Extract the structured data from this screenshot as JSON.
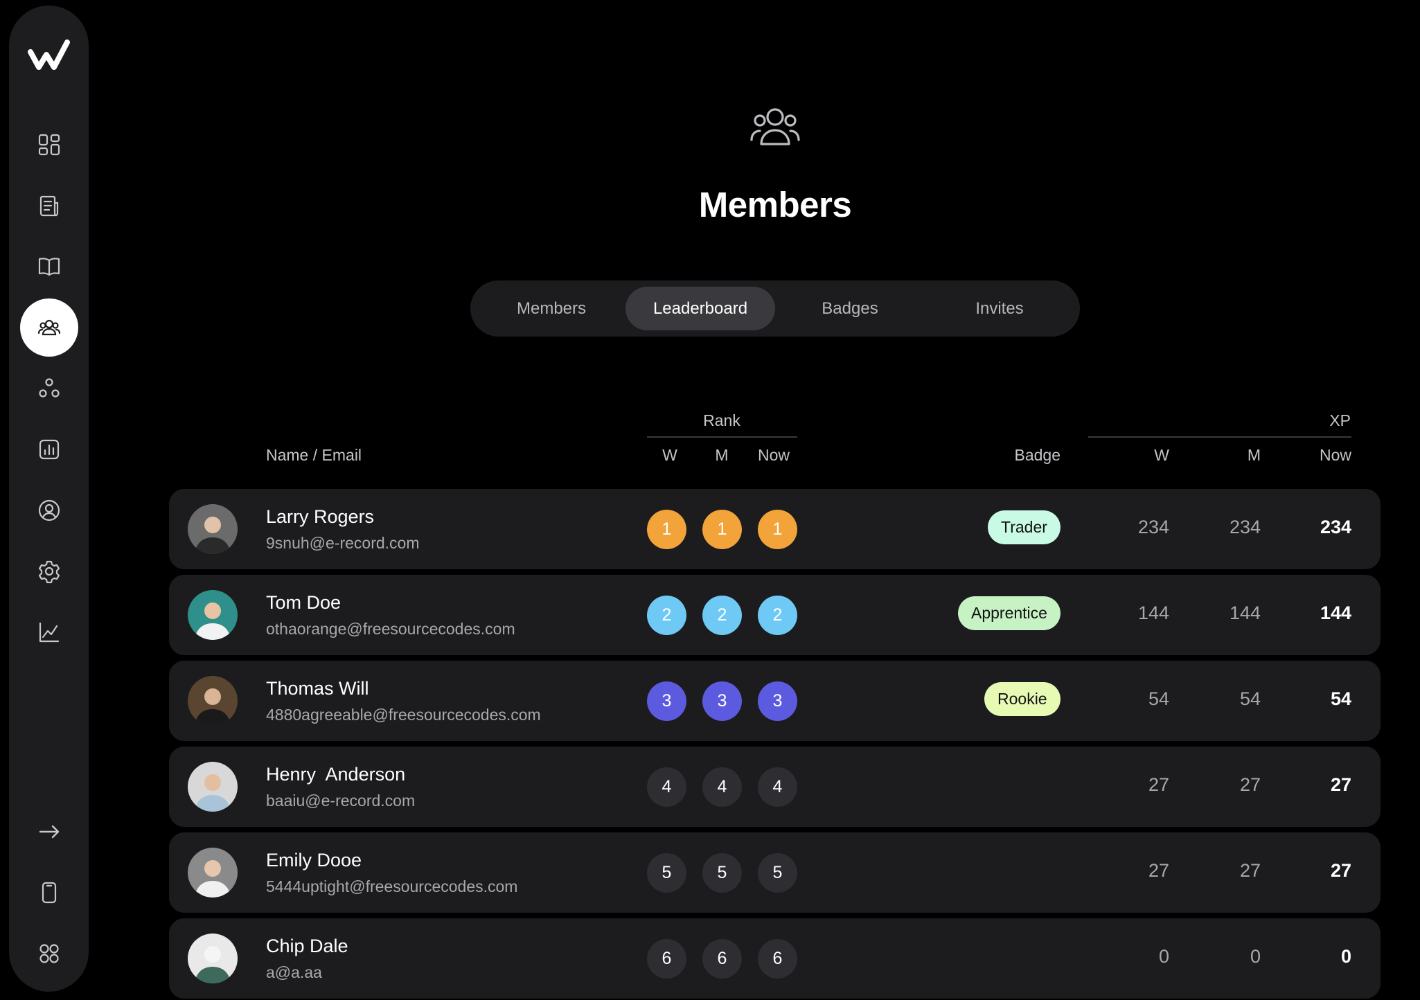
{
  "sidebar": {
    "logo": "w-logo",
    "items": [
      {
        "icon": "dashboard-icon",
        "active": false
      },
      {
        "icon": "news-icon",
        "active": false
      },
      {
        "icon": "book-icon",
        "active": false
      },
      {
        "icon": "members-icon",
        "active": true
      },
      {
        "icon": "groups-icon",
        "active": false
      },
      {
        "icon": "analytics-icon",
        "active": false
      },
      {
        "icon": "profile-icon",
        "active": false
      },
      {
        "icon": "settings-icon",
        "active": false
      },
      {
        "icon": "chart-icon",
        "active": false
      }
    ],
    "bottom": [
      {
        "icon": "arrow-right-icon"
      },
      {
        "icon": "mobile-icon"
      },
      {
        "icon": "apps-icon"
      }
    ]
  },
  "header": {
    "icon": "members-icon",
    "title": "Members"
  },
  "tabs": [
    {
      "label": "Members",
      "active": false
    },
    {
      "label": "Leaderboard",
      "active": true
    },
    {
      "label": "Badges",
      "active": false
    },
    {
      "label": "Invites",
      "active": false
    }
  ],
  "table": {
    "name_header": "Name / Email",
    "rank_group": "Rank",
    "rank_w": "W",
    "rank_m": "M",
    "rank_now": "Now",
    "badge_header": "Badge",
    "xp_group": "XP",
    "xp_w": "W",
    "xp_m": "M",
    "xp_now": "Now"
  },
  "rows": [
    {
      "name": "Larry Rogers",
      "email": "9snuh@e-record.com",
      "rank_w": "1",
      "rank_m": "1",
      "rank_now": "1",
      "rank_color": "#f2a33a",
      "badge": "Trader",
      "badge_color": "#c8fae6",
      "xp_w": "234",
      "xp_m": "234",
      "xp_now": "234"
    },
    {
      "name": "Tom Doe",
      "email": "othaorange@freesourcecodes.com",
      "rank_w": "2",
      "rank_m": "2",
      "rank_now": "2",
      "rank_color": "#6ec9f5",
      "badge": "Apprentice",
      "badge_color": "#c6f2c4",
      "xp_w": "144",
      "xp_m": "144",
      "xp_now": "144"
    },
    {
      "name": "Thomas Will",
      "email": "4880agreeable@freesourcecodes.com",
      "rank_w": "3",
      "rank_m": "3",
      "rank_now": "3",
      "rank_color": "#5c5be0",
      "badge": "Rookie",
      "badge_color": "#e6fab4",
      "xp_w": "54",
      "xp_m": "54",
      "xp_now": "54"
    },
    {
      "name": "Henry  Anderson",
      "email": "baaiu@e-record.com",
      "rank_w": "4",
      "rank_m": "4",
      "rank_now": "4",
      "rank_color": "#2e2e32",
      "badge": "",
      "badge_color": "",
      "xp_w": "27",
      "xp_m": "27",
      "xp_now": "27"
    },
    {
      "name": "Emily Dooe",
      "email": "5444uptight@freesourcecodes.com",
      "rank_w": "5",
      "rank_m": "5",
      "rank_now": "5",
      "rank_color": "#2e2e32",
      "badge": "",
      "badge_color": "",
      "xp_w": "27",
      "xp_m": "27",
      "xp_now": "27"
    },
    {
      "name": "Chip Dale",
      "email": "a@a.aa",
      "rank_w": "6",
      "rank_m": "6",
      "rank_now": "6",
      "rank_color": "#2e2e32",
      "badge": "",
      "badge_color": "",
      "xp_w": "0",
      "xp_m": "0",
      "xp_now": "0"
    }
  ]
}
